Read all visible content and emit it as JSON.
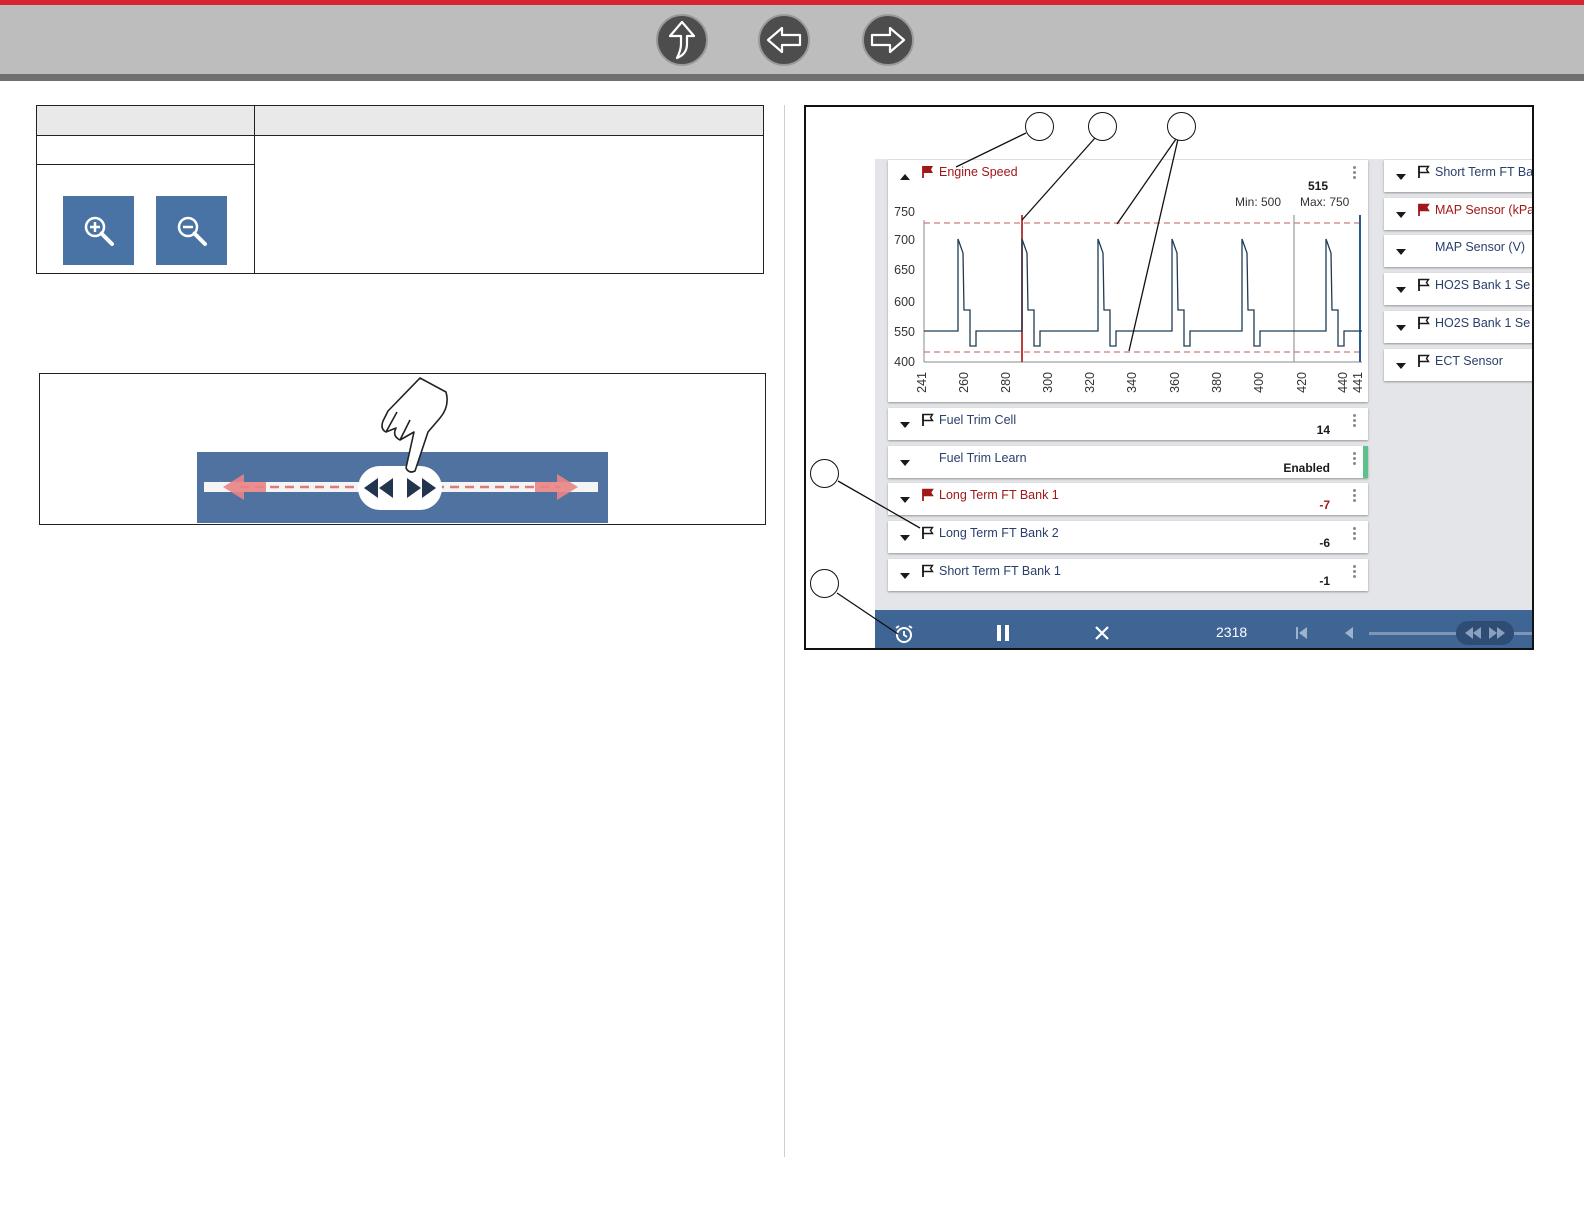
{
  "header": {
    "nav": [
      {
        "name": "home-button",
        "icon": "up-arrow-icon"
      },
      {
        "name": "back-button",
        "icon": "left-arrow-icon"
      },
      {
        "name": "forward-button",
        "icon": "right-arrow-icon"
      }
    ],
    "colors": {
      "accent": "#d72630",
      "bar": "#bdbdbd",
      "button": "#4d4d4d"
    }
  },
  "zoom_table": {
    "zoom_in_icon": "zoom-in-icon",
    "zoom_out_icon": "zoom-out-icon"
  },
  "scrub_figure": {
    "icons": [
      "hand-pointer-icon",
      "rewind-icon",
      "fast-forward-icon",
      "left-arrow-icon",
      "right-arrow-icon"
    ]
  },
  "data_screen": {
    "graph": {
      "title": "Engine Speed",
      "current_value": "515",
      "min_label": "Min: 500",
      "max_label": "Max: 750",
      "y_ticks": [
        "750",
        "700",
        "650",
        "600",
        "550",
        "400"
      ],
      "x_ticks": [
        "241",
        "260",
        "280",
        "300",
        "320",
        "340",
        "360",
        "380",
        "400",
        "420",
        "440",
        "441"
      ]
    },
    "pids": [
      {
        "name": "Fuel Trim Cell",
        "value": "14",
        "flag": "outline"
      },
      {
        "name": "Fuel Trim Learn",
        "value": "Enabled",
        "flag": "none"
      },
      {
        "name": "Long Term FT Bank 1",
        "value": "-7",
        "flag": "filled"
      },
      {
        "name": "Long Term FT Bank 2",
        "value": "-6",
        "flag": "outline"
      },
      {
        "name": "Short Term FT Bank 1",
        "value": "-1",
        "flag": "outline"
      }
    ],
    "right_pids": [
      {
        "name": "Short Term FT Ba",
        "flag": "outline"
      },
      {
        "name": "MAP Sensor (kPa",
        "flag": "filled"
      },
      {
        "name": "MAP Sensor (V)",
        "flag": "none"
      },
      {
        "name": "HO2S Bank 1 Se",
        "flag": "outline"
      },
      {
        "name": "HO2S Bank 1 Se",
        "flag": "outline"
      },
      {
        "name": "ECT Sensor",
        "flag": "outline"
      }
    ],
    "toolbar": {
      "frame_counter": "2318",
      "icons": [
        "snapshot-icon",
        "pause-icon",
        "close-icon",
        "skip-start-icon",
        "step-back-icon",
        "rewind-icon",
        "fast-forward-icon"
      ]
    },
    "colors": {
      "toolbar": "#3f6594",
      "flag_red": "#a01818",
      "trace": "#1d3c55",
      "enabled_bar": "#5cc28a"
    }
  }
}
